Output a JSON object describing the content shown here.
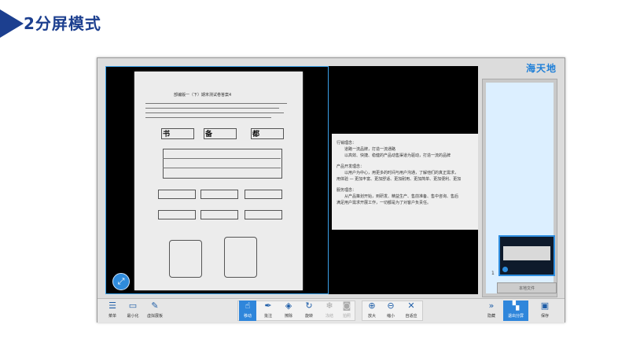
{
  "slide": {
    "title": "2分屏模式"
  },
  "app": {
    "brand": "海天地",
    "accent": "#2f86db",
    "paper_header": "部编版一（下）期末测试卷答案4",
    "paper_glyphs": [
      "书",
      "备",
      "都"
    ],
    "doc_lines": [
      {
        "text": "行销理念：",
        "cls": ""
      },
      {
        "text": "道路一流品牌，打造一流通路",
        "cls": "ind"
      },
      {
        "text": "以高效、快捷、稳健的产品动售渠道为驱动，打造一流的品牌",
        "cls": "ind"
      },
      {
        "text": "产品开发理念：",
        "cls": "sec"
      },
      {
        "text": "以用户为中心，用更多的时间与用户沟通，了解他们的真正需求，",
        "cls": "ind"
      },
      {
        "text": "用体验 — 更加丰富、更加舒适、更加耐用、更加简单、更加便利、更加",
        "cls": ""
      },
      {
        "text": "服务理念：",
        "cls": "sec"
      },
      {
        "text": "从产品策划开始，到研发、精益生产、售前准备、售中咨询、售后",
        "cls": "ind"
      },
      {
        "text": "满足用户需求开展工作，一切都是为了对客户负责任。",
        "cls": ""
      }
    ],
    "sidebar": {
      "page_number": "1",
      "local_file_label": "本地文件"
    },
    "toolbar": {
      "menu": "菜单",
      "minimize": "最小化",
      "virtual_stand": "虚拟展板",
      "move": "移动",
      "annotate": "批注",
      "eraser": "擦除",
      "rotate": "旋转",
      "freeze": "冻结",
      "capture": "拍照",
      "zoom_in": "放大",
      "zoom_out": "缩小",
      "fit": "自适应",
      "hide": "隐藏",
      "exit_split": "退出分屏",
      "save": "保存"
    }
  }
}
